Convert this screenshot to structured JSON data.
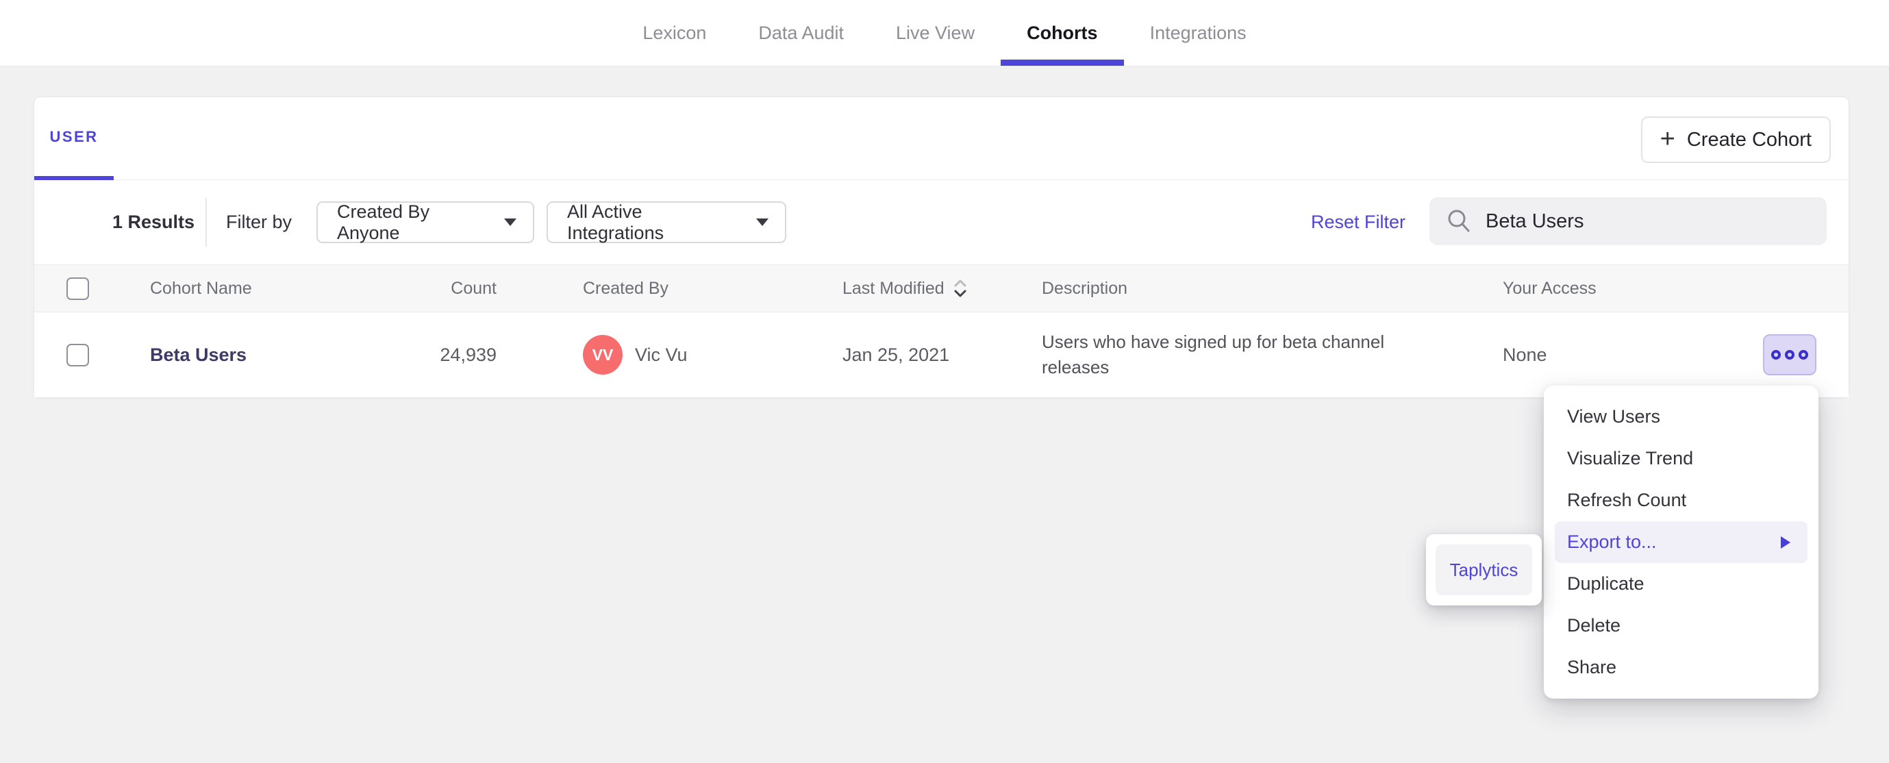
{
  "nav": {
    "tabs": [
      {
        "label": "Lexicon",
        "active": false
      },
      {
        "label": "Data Audit",
        "active": false
      },
      {
        "label": "Live View",
        "active": false
      },
      {
        "label": "Cohorts",
        "active": true
      },
      {
        "label": "Integrations",
        "active": false
      }
    ]
  },
  "cohorts_page": {
    "type_tab_label": "USER",
    "create_button": {
      "plus_glyph": "+",
      "label": "Create Cohort"
    },
    "filters": {
      "results_count": "1 Results",
      "filter_by_label": "Filter by",
      "created_by_dropdown_value": "Created By Anyone",
      "integrations_dropdown_value": "All Active Integrations",
      "reset_filter_label": "Reset Filter",
      "search_value": "Beta Users"
    },
    "table": {
      "headers": {
        "cohort_name": "Cohort Name",
        "count": "Count",
        "created_by": "Created By",
        "last_modified": "Last Modified",
        "description": "Description",
        "your_access": "Your Access"
      },
      "rows": [
        {
          "name": "Beta Users",
          "count": "24,939",
          "created_by_initials": "VV",
          "created_by": "Vic Vu",
          "last_modified": "Jan 25, 2021",
          "description": "Users who have signed up for beta channel releases",
          "your_access": "None"
        }
      ]
    }
  },
  "context_menu": {
    "items": [
      {
        "label": "View Users",
        "highlighted": false
      },
      {
        "label": "Visualize Trend",
        "highlighted": false
      },
      {
        "label": "Refresh Count",
        "highlighted": false
      },
      {
        "label": "Export to...",
        "highlighted": true,
        "has_submenu": true
      },
      {
        "label": "Duplicate",
        "highlighted": false
      },
      {
        "label": "Delete",
        "highlighted": false
      },
      {
        "label": "Share",
        "highlighted": false
      }
    ]
  },
  "export_submenu": {
    "items": [
      {
        "label": "Taplytics"
      }
    ]
  },
  "icons": {
    "search": "search-icon",
    "sort": "sort-icon",
    "more": "more-options-icon",
    "caret": "caret-down-icon",
    "plus": "plus-icon",
    "submenu_arrow": "submenu-arrow-icon"
  },
  "colors": {
    "accent": "#4f44d9",
    "avatar": "#f76d6d",
    "page_background": "#f1f1f2",
    "row_highlight": "#f1f0f8",
    "more_button_bg": "#dcd8f5"
  }
}
